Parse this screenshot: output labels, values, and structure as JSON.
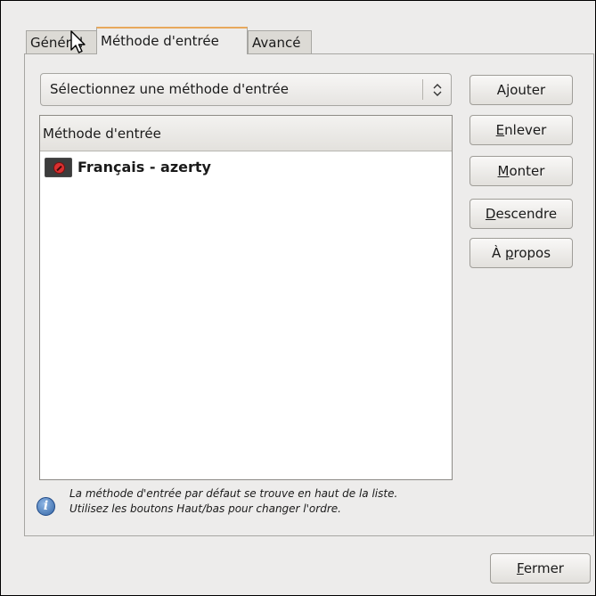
{
  "tabs": {
    "general": "Général",
    "methode": "Méthode d'entrée",
    "avance": "Avancé"
  },
  "combo": {
    "selected": "Sélectionnez une méthode d'entrée"
  },
  "list": {
    "header": "Méthode d'entrée",
    "rows": [
      {
        "label": "Français - azerty"
      }
    ]
  },
  "buttons": {
    "ajouter": {
      "pre": "A",
      "ul": "j",
      "post": "outer"
    },
    "enlever": {
      "pre": "",
      "ul": "E",
      "post": "nlever"
    },
    "monter": {
      "pre": "",
      "ul": "M",
      "post": "onter"
    },
    "descendre": {
      "pre": "",
      "ul": "D",
      "post": "escendre"
    },
    "apropos": {
      "pre": "À ",
      "ul": "p",
      "post": "ropos"
    },
    "fermer": {
      "pre": "",
      "ul": "F",
      "post": "ermer"
    }
  },
  "info": {
    "line1": "La méthode d'entrée par défaut se trouve en haut de la liste.",
    "line2": "Utilisez les boutons Haut/bas pour changer l'ordre."
  },
  "colors": {
    "active_tab_accent": "#e8a85c",
    "window_bg": "#edeceb",
    "info_icon": "#3465a4"
  },
  "icons": {
    "row_icon": "stop-sign-icon",
    "info": "info-icon",
    "combo_arrow": "up-down-arrow-icon",
    "pointer": "mouse-pointer-icon"
  }
}
